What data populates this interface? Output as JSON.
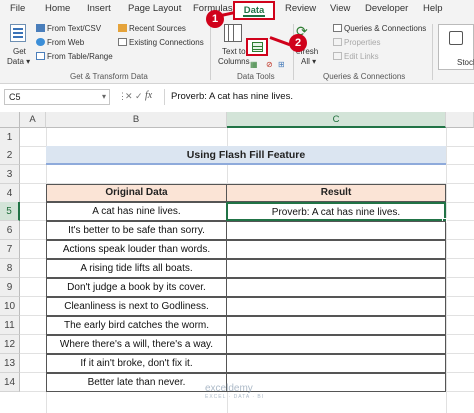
{
  "tabs": [
    {
      "label": "File"
    },
    {
      "label": "Home"
    },
    {
      "label": "Insert"
    },
    {
      "label": "Page Layout"
    },
    {
      "label": "Formulas"
    },
    {
      "label": "Data"
    },
    {
      "label": "Review"
    },
    {
      "label": "View"
    },
    {
      "label": "Developer"
    },
    {
      "label": "Help"
    }
  ],
  "ribbon": {
    "get_data_line1": "Get",
    "get_data_line2": "Data ▾",
    "from_text_csv": "From Text/CSV",
    "from_web": "From Web",
    "from_table_range": "From Table/Range",
    "recent_sources": "Recent Sources",
    "existing_connections": "Existing Connections",
    "group_get_transform": "Get & Transform Data",
    "text_to_columns_line1": "Text to",
    "text_to_columns_line2": "Columns",
    "group_data_tools": "Data Tools",
    "refresh_line1": "efresh",
    "refresh_line2": "All ▾",
    "queries_connections": "Queries & Connections",
    "properties": "Properties",
    "edit_links": "Edit Links",
    "group_queries_connections": "Queries & Connections",
    "stocks_label": "Stock"
  },
  "callouts": {
    "one": "1",
    "two": "2"
  },
  "formula_bar": {
    "name_box": "C5",
    "cancel_symbol": "✕",
    "enter_symbol": "✓",
    "fx_symbol": "fx",
    "formula": "Proverb: A cat has nine lives."
  },
  "columns": [
    "A",
    "B",
    "C"
  ],
  "rows": [
    "1",
    "2",
    "3",
    "4",
    "5",
    "6",
    "7",
    "8",
    "9",
    "10",
    "11",
    "12",
    "13",
    "14"
  ],
  "sheet": {
    "title": "Using Flash Fill Feature",
    "header_original": "Original Data",
    "header_result": "Result",
    "original": [
      "A cat has nine lives.",
      "It's better to be safe than sorry.",
      "Actions speak louder than words.",
      "A rising tide lifts all boats.",
      "Don't judge a book by its cover.",
      "Cleanliness is next to Godliness.",
      "The early bird catches the worm.",
      "Where there's a will, there's a way.",
      "If it ain't broke, don't fix it.",
      "Better late than never."
    ],
    "result": [
      "Proverb: A cat has nine lives.",
      "",
      "",
      "",
      "",
      "",
      "",
      "",
      "",
      ""
    ]
  },
  "watermark": {
    "name": "exceldemy",
    "tagline": "EXCEL · DATA · BI"
  },
  "colors": {
    "accent": "#217346",
    "callout": "#d0021b",
    "header_fill": "#fbe4d6",
    "title_fill": "#dbe5f1"
  }
}
